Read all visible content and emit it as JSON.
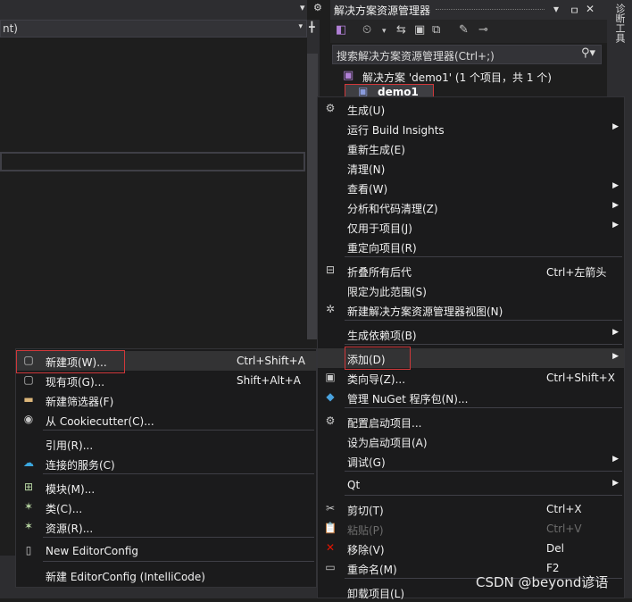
{
  "editor": {
    "nav_text": "nt)",
    "nav_arrow": "▾",
    "top_symbols": [
      "▾",
      "⚙",
      "╋"
    ]
  },
  "solution_explorer": {
    "title": "解决方案资源管理器",
    "search_placeholder": "搜索解决方案资源管理器(Ctrl+;)",
    "solution_label": "解决方案 'demo1' (1 个项目，共 1 个)",
    "project_label": "demo1",
    "header_controls": [
      "▾",
      "ㅁ",
      "✕"
    ],
    "right_tab": "诊断工具"
  },
  "main_menu": {
    "items": [
      {
        "icon": "build-icon",
        "glyph": "⚙",
        "label": "生成(U)",
        "shortcut": "",
        "submenu": false
      },
      {
        "icon": "",
        "glyph": "",
        "label": "运行 Build Insights",
        "shortcut": "",
        "submenu": true
      },
      {
        "icon": "",
        "glyph": "",
        "label": "重新生成(E)",
        "shortcut": "",
        "submenu": false
      },
      {
        "icon": "",
        "glyph": "",
        "label": "清理(N)",
        "shortcut": "",
        "submenu": false
      },
      {
        "icon": "",
        "glyph": "",
        "label": "查看(W)",
        "shortcut": "",
        "submenu": true
      },
      {
        "icon": "",
        "glyph": "",
        "label": "分析和代码清理(Z)",
        "shortcut": "",
        "submenu": true
      },
      {
        "icon": "",
        "glyph": "",
        "label": "仅用于项目(J)",
        "shortcut": "",
        "submenu": true
      },
      {
        "icon": "",
        "glyph": "",
        "label": "重定向项目(R)",
        "shortcut": "",
        "submenu": false
      },
      {
        "icon": "collapse-icon",
        "glyph": "⊟",
        "label": "折叠所有后代",
        "shortcut": "Ctrl+左箭头",
        "submenu": false
      },
      {
        "icon": "",
        "glyph": "",
        "label": "限定为此范围(S)",
        "shortcut": "",
        "submenu": false
      },
      {
        "icon": "new-view-icon",
        "glyph": "✲",
        "label": "新建解决方案资源管理器视图(N)",
        "shortcut": "",
        "submenu": false
      },
      {
        "icon": "",
        "glyph": "",
        "label": "生成依赖项(B)",
        "shortcut": "",
        "submenu": true
      },
      {
        "icon": "",
        "glyph": "",
        "label": "添加(D)",
        "shortcut": "",
        "submenu": true
      },
      {
        "icon": "class-wizard-icon",
        "glyph": "▣",
        "label": "类向导(Z)...",
        "shortcut": "Ctrl+Shift+X",
        "submenu": false
      },
      {
        "icon": "nuget-icon",
        "glyph": "◆",
        "label": "管理 NuGet 程序包(N)...",
        "shortcut": "",
        "submenu": false
      },
      {
        "icon": "settings-icon",
        "glyph": "⚙",
        "label": "配置启动项目...",
        "shortcut": "",
        "submenu": false
      },
      {
        "icon": "",
        "glyph": "",
        "label": "设为启动项目(A)",
        "shortcut": "",
        "submenu": false
      },
      {
        "icon": "",
        "glyph": "",
        "label": "调试(G)",
        "shortcut": "",
        "submenu": true
      },
      {
        "icon": "",
        "glyph": "",
        "label": "Qt",
        "shortcut": "",
        "submenu": true
      },
      {
        "icon": "cut-icon",
        "glyph": "✂",
        "label": "剪切(T)",
        "shortcut": "Ctrl+X",
        "submenu": false
      },
      {
        "icon": "paste-icon",
        "glyph": "📋",
        "label": "粘贴(P)",
        "shortcut": "Ctrl+V",
        "submenu": false
      },
      {
        "icon": "remove-icon",
        "glyph": "✕",
        "label": "移除(V)",
        "shortcut": "Del",
        "submenu": false
      },
      {
        "icon": "rename-icon",
        "glyph": "▭",
        "label": "重命名(M)",
        "shortcut": "F2",
        "submenu": false
      },
      {
        "icon": "",
        "glyph": "",
        "label": "卸载项目(L)",
        "shortcut": "",
        "submenu": false
      }
    ]
  },
  "add_menu": {
    "items": [
      {
        "icon": "new-item-icon",
        "glyph": "▢",
        "label": "新建项(W)...",
        "shortcut": "Ctrl+Shift+A"
      },
      {
        "icon": "existing-item-icon",
        "glyph": "▢",
        "label": "现有项(G)...",
        "shortcut": "Shift+Alt+A"
      },
      {
        "icon": "new-filter-icon",
        "glyph": "▬",
        "label": "新建筛选器(F)",
        "shortcut": ""
      },
      {
        "icon": "cookiecutter-icon",
        "glyph": "◉",
        "label": "从 Cookiecutter(C)...",
        "shortcut": ""
      },
      {
        "icon": "",
        "glyph": "",
        "label": "引用(R)...",
        "shortcut": ""
      },
      {
        "icon": "connected-service-icon",
        "glyph": "☁",
        "label": "连接的服务(C)",
        "shortcut": ""
      },
      {
        "icon": "module-icon",
        "glyph": "⊞",
        "label": "模块(M)...",
        "shortcut": ""
      },
      {
        "icon": "class-icon",
        "glyph": "✶",
        "label": "类(C)...",
        "shortcut": ""
      },
      {
        "icon": "resource-icon",
        "glyph": "✶",
        "label": "资源(R)...",
        "shortcut": ""
      },
      {
        "icon": "editorconfig-icon",
        "glyph": "▯",
        "label": "New EditorConfig",
        "shortcut": ""
      },
      {
        "icon": "",
        "glyph": "",
        "label": "新建 EditorConfig (IntelliCode)",
        "shortcut": ""
      }
    ]
  },
  "watermark": "CSDN @beyond谚语",
  "colors": {
    "highlight_border": "#d0383a",
    "menu_bg": "#1b1b1c",
    "background": "#1e1e1e"
  }
}
